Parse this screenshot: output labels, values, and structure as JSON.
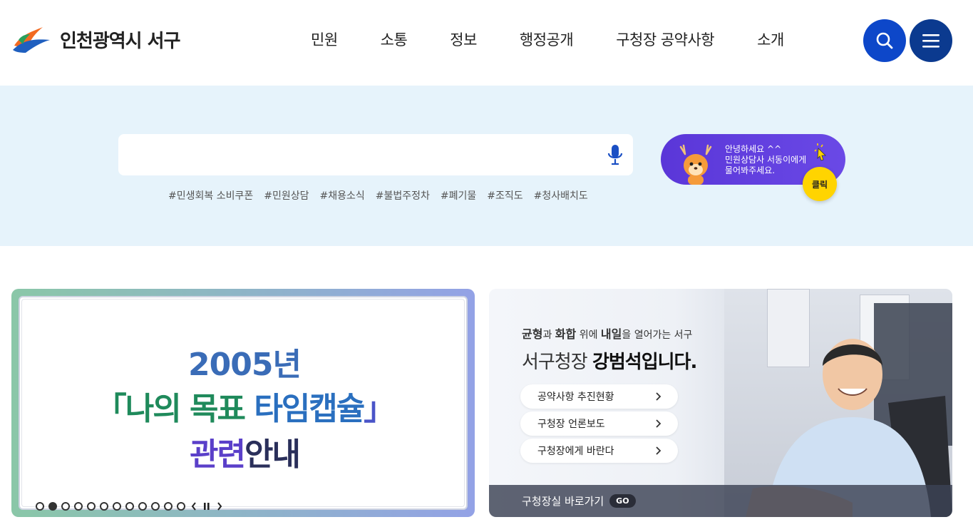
{
  "header": {
    "logo_text": "인천광역시 서구",
    "nav": [
      "민원",
      "소통",
      "정보",
      "행정공개",
      "구청장 공약사항",
      "소개"
    ]
  },
  "search": {
    "placeholder": "",
    "tags": [
      "#민생회복 소비쿠폰",
      "#민원상담",
      "#채용소식",
      "#불법주정차",
      "#폐기물",
      "#조직도",
      "#청사배치도"
    ]
  },
  "chatbot": {
    "line1": "안녕하세요 ^^",
    "line2": "민원상담사 서동이에게",
    "line3": "물어봐주세요.",
    "click": "클릭"
  },
  "banner": {
    "line1": "2005년",
    "line2_open": "「",
    "line2_a": "나의 ",
    "line2_b": "목표 ",
    "line2_c": "타임캡슐",
    "line2_close": "」",
    "line3_a": "관련",
    "line3_b": "안내",
    "slide_count": 12,
    "active_slide": 2
  },
  "mayor": {
    "slogan_part1": "균형",
    "slogan_part2": "과 ",
    "slogan_part3": "화합",
    "slogan_part4": " 위에 ",
    "slogan_part5": "내일",
    "slogan_part6": "을 열어가는 서구",
    "title_prefix": "서구청장 ",
    "title_name": "강범석",
    "title_suffix": "입니다.",
    "links": [
      "공약사항 추진현황",
      "구청장 언론보도",
      "구청장에게 바란다"
    ],
    "bar_label": "구청장실 바로가기",
    "go": "GO"
  },
  "colors": {
    "primary_blue": "#0d47c9",
    "menu_navy": "#0b3a8f",
    "search_band_bg": "#e6f3fb",
    "chatbot_purple": "#5a36d8",
    "click_yellow": "#ffd400"
  }
}
